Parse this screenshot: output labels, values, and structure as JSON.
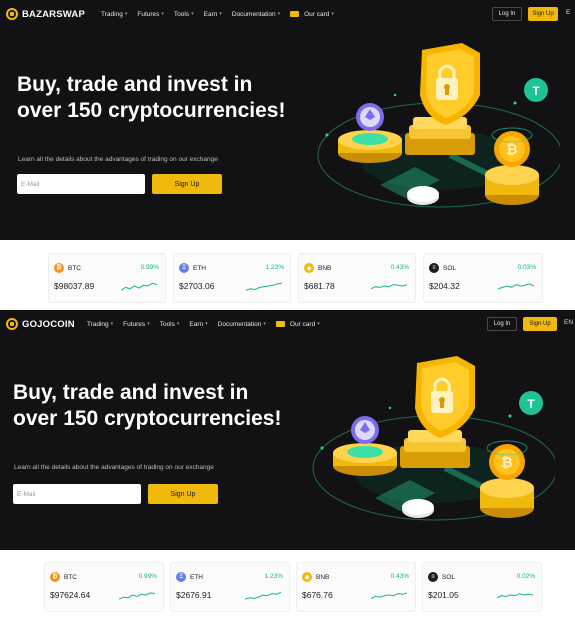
{
  "panels": [
    {
      "brand": "BAZARSWAP",
      "nav": [
        "Trading",
        "Futures",
        "Tools",
        "Earn",
        "Documentation",
        "Our card"
      ],
      "login": "Log In",
      "signup": "Sign Up",
      "lang": "E",
      "headline": "Buy, trade and invest in over 150 cryptocurrencies!",
      "subtitle": "Learn all the details about the advantages of trading on our exchange",
      "email_placeholder": "E-Mail",
      "cta": "Sign Up",
      "tickers": [
        {
          "symbol": "BTC",
          "change": "0.99%",
          "price": "$98037.89",
          "color": "#f7931a",
          "glyph": "₿",
          "spark": [
            0.2,
            0.4,
            0.3,
            0.5,
            0.35,
            0.55,
            0.5,
            0.7,
            0.6
          ]
        },
        {
          "symbol": "ETH",
          "change": "1.23%",
          "price": "$2703.06",
          "color": "#627eea",
          "glyph": "Ξ",
          "spark": [
            0.2,
            0.3,
            0.25,
            0.4,
            0.45,
            0.5,
            0.55,
            0.65,
            0.7
          ]
        },
        {
          "symbol": "BNB",
          "change": "0.43%",
          "price": "$681.78",
          "color": "#f0b90b",
          "glyph": "◆",
          "spark": [
            0.3,
            0.45,
            0.4,
            0.5,
            0.45,
            0.6,
            0.55,
            0.5,
            0.6
          ]
        },
        {
          "symbol": "SOL",
          "change": "0.03%",
          "price": "$204.32",
          "color": "#1b1b1b",
          "glyph": "≡",
          "spark": [
            0.3,
            0.4,
            0.5,
            0.4,
            0.6,
            0.5,
            0.55,
            0.65,
            0.5
          ]
        }
      ]
    },
    {
      "brand": "GOJOCOIN",
      "nav": [
        "Trading",
        "Futures",
        "Tools",
        "Earn",
        "Documentation",
        "Our card"
      ],
      "login": "Log In",
      "signup": "Sign Up",
      "lang": "EN",
      "headline": "Buy, trade and invest in over 150 cryptocurrencies!",
      "subtitle": "Learn all the details about the advantages of trading on our exchange",
      "email_placeholder": "E-Mail",
      "cta": "Sign Up",
      "tickers": [
        {
          "symbol": "BTC",
          "change": "0.99%",
          "price": "$97624.64",
          "color": "#f7931a",
          "glyph": "₿",
          "spark": [
            0.2,
            0.35,
            0.3,
            0.5,
            0.4,
            0.55,
            0.5,
            0.65,
            0.6
          ]
        },
        {
          "symbol": "ETH",
          "change": "1.23%",
          "price": "$2676.91",
          "color": "#627eea",
          "glyph": "Ξ",
          "spark": [
            0.2,
            0.3,
            0.25,
            0.35,
            0.5,
            0.45,
            0.6,
            0.55,
            0.7
          ]
        },
        {
          "symbol": "BNB",
          "change": "0.43%",
          "price": "$676.76",
          "color": "#f0b90b",
          "glyph": "◆",
          "spark": [
            0.25,
            0.4,
            0.35,
            0.45,
            0.5,
            0.45,
            0.6,
            0.55,
            0.65
          ]
        },
        {
          "symbol": "SOL",
          "change": "0.02%",
          "price": "$201.05",
          "color": "#1b1b1b",
          "glyph": "≡",
          "spark": [
            0.3,
            0.45,
            0.4,
            0.5,
            0.45,
            0.6,
            0.5,
            0.55,
            0.5
          ]
        }
      ]
    }
  ]
}
